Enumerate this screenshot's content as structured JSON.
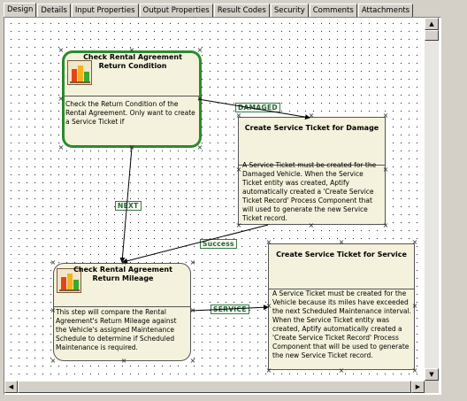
{
  "tabs": [
    {
      "label": "Design",
      "active": true
    },
    {
      "label": "Details",
      "active": false
    },
    {
      "label": "Input Properties",
      "active": false
    },
    {
      "label": "Output Properties",
      "active": false
    },
    {
      "label": "Result Codes",
      "active": false
    },
    {
      "label": "Security",
      "active": false
    },
    {
      "label": "Comments",
      "active": false
    },
    {
      "label": "Attachments",
      "active": false
    }
  ],
  "nodes": {
    "check_condition": {
      "title": "Check Rental Agreement Return Condition",
      "description": "Check the Return Condition of the Rental Agreement. Only want to create a Service Ticket if"
    },
    "ticket_damage": {
      "title": "Create Service Ticket for Damage",
      "description": "A Service Ticket must be created for the Damaged Vehicle. When the Service Ticket entity was created, Aptify automatically created a 'Create Service Ticket Record' Process Component that will used to generate the new Service Ticket record."
    },
    "check_mileage": {
      "title": "Check Rental Agreement Return Mileage",
      "description": "This step will compare the Rental Agreement's Return Mileage against the Vehicle's assigned Maintenance Schedule to determine if Scheduled Maintenance is required."
    },
    "ticket_service": {
      "title": "Create Service Ticket for Service",
      "description": "A Service Ticket must be created for the Vehicle because its miles have exceeded the next Scheduled Maintenance interval. When the Service Ticket entity was created, Aptify automatically created a 'Create Service Ticket Record' Process Component that will be used to generate the new Service Ticket record."
    }
  },
  "connectors": {
    "damaged": "DAMAGED",
    "next": "NEXT",
    "success": "Success",
    "service": "SERVICE"
  },
  "icons": {
    "process": "process-chart-icon",
    "handle": "x-handle-icon",
    "scroll_up": "scroll-up-icon",
    "scroll_down": "scroll-down-icon",
    "scroll_left": "scroll-left-icon",
    "scroll_right": "scroll-right-icon"
  },
  "colors": {
    "node_fill": "#f4f2dc",
    "selected_border": "#2d8a2d",
    "label_text": "#1f6b35"
  }
}
